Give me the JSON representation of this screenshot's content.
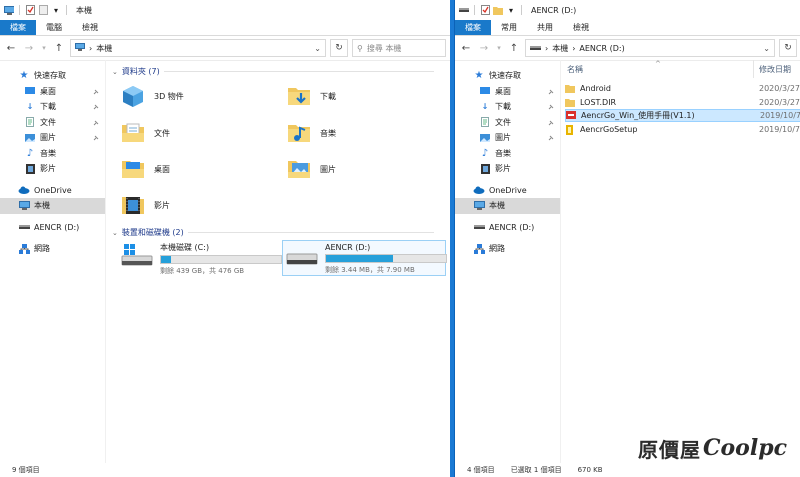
{
  "left": {
    "title": "本機",
    "tabs": [
      "檔案",
      "電腦",
      "檢視"
    ],
    "address": "本機",
    "search_placeholder": "搜尋 本機",
    "nav": {
      "quick_access": "快速存取",
      "qa_items": [
        "桌面",
        "下載",
        "文件",
        "圖片",
        "音樂",
        "影片"
      ],
      "onedrive": "OneDrive",
      "this_pc": "本機",
      "aencr": "AENCR (D:)",
      "network": "網路"
    },
    "folders_header": "資料夾 (7)",
    "folders": [
      "3D 物件",
      "下載",
      "文件",
      "音樂",
      "桌面",
      "圖片",
      "影片"
    ],
    "devices_header": "裝置和磁碟機 (2)",
    "drives": [
      {
        "name": "本機磁碟 (C:)",
        "caption": "剩餘 439 GB，共 476 GB",
        "used": 0.08
      },
      {
        "name": "AENCR (D:)",
        "caption": "剩餘 3.44 MB，共 7.90 MB",
        "used": 0.56
      }
    ],
    "status": "9 個項目"
  },
  "right": {
    "title": "AENCR (D:)",
    "tabs": [
      "檔案",
      "常用",
      "共用",
      "檢視"
    ],
    "address_parts": [
      "本機",
      "AENCR (D:)"
    ],
    "nav": {
      "quick_access": "快速存取",
      "qa_items": [
        "桌面",
        "下載",
        "文件",
        "圖片",
        "音樂",
        "影片"
      ],
      "onedrive": "OneDrive",
      "this_pc": "本機",
      "aencr": "AENCR (D:)",
      "network": "網路"
    },
    "columns": {
      "name": "名稱",
      "date": "修改日期"
    },
    "files": [
      {
        "name": "Android",
        "date": "2020/3/27",
        "icon": "folder-icon"
      },
      {
        "name": "LOST.DIR",
        "date": "2020/3/27",
        "icon": "folder-icon"
      },
      {
        "name": "AencrGo_Win_使用手冊(V1.1)",
        "date": "2019/10/7",
        "icon": "pdf-icon"
      },
      {
        "name": "AencrGoSetup",
        "date": "2019/10/7",
        "icon": "setup-icon"
      }
    ],
    "status_count": "4 個項目",
    "status_selected": "已選取 1 個項目",
    "status_size": "670 KB"
  },
  "watermark": {
    "cn": "原價屋",
    "en": "Coolpc"
  },
  "colors": {
    "accent": "#1979ca",
    "desktop": "#1a7ad4",
    "folder": "#f0c75e",
    "select": "#cce8ff"
  }
}
